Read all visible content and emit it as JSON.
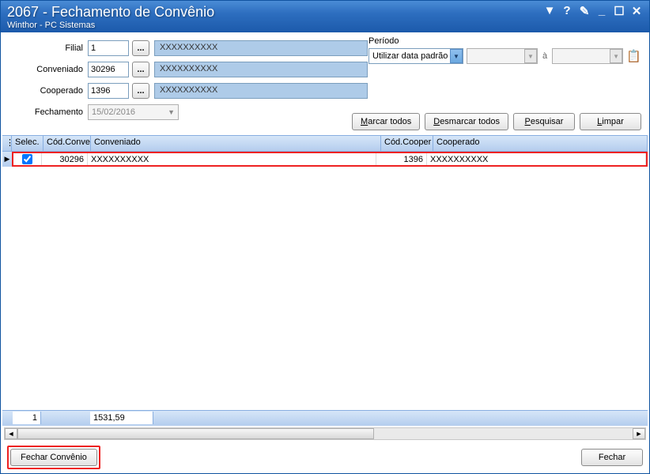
{
  "title": "2067 - Fechamento de Convênio",
  "subtitle": "Winthor - PC Sistemas",
  "form": {
    "filial_label": "Filial",
    "filial_value": "1",
    "filial_display": "XXXXXXXXXX",
    "conveniado_label": "Conveniado",
    "conveniado_value": "30296",
    "conveniado_display": "XXXXXXXXXX",
    "cooperado_label": "Cooperado",
    "cooperado_value": "1396",
    "cooperado_display": "XXXXXXXXXX",
    "fechamento_label": "Fechamento",
    "fechamento_value": "15/02/2016"
  },
  "periodo": {
    "legend": "Período",
    "option": "Utilizar data padrão",
    "a_label": "à"
  },
  "buttons": {
    "marcar": "Marcar todos",
    "desmarcar": "Desmarcar todos",
    "pesquisar": "Pesquisar",
    "limpar": "Limpar",
    "fechar_convenio": "Fechar Convênio",
    "fechar": "Fechar"
  },
  "grid": {
    "headers": {
      "selec": "Selec.",
      "cod_conver": "Cód.Conver",
      "conveniado": "Conveniado",
      "cod_cooper": "Cód.Cooper",
      "cooperado": "Cooperado"
    },
    "row": {
      "cod_conver": "30296",
      "conveniado": "XXXXXXXXXX",
      "cod_cooper": "1396",
      "cooperado": "XXXXXXXXXX"
    },
    "footer": {
      "count": "1",
      "total": "1531,59"
    }
  },
  "browse": "..."
}
